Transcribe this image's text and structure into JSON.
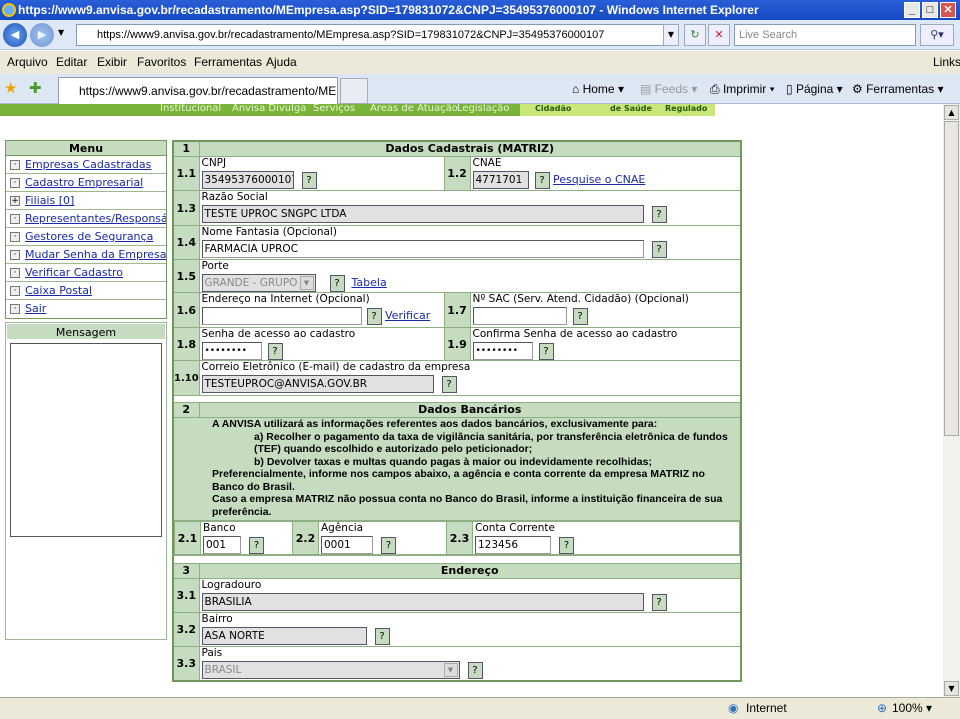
{
  "window": {
    "title": "https://www9.anvisa.gov.br/recadastramento/MEmpresa.asp?SID=179831072&CNPJ=35495376000107 - Windows Internet Explorer"
  },
  "browser": {
    "address": "https://www9.anvisa.gov.br/recadastramento/MEmpresa.asp?SID=179831072&CNPJ=35495376000107",
    "search_placeholder": "Live Search",
    "menu": [
      "Arquivo",
      "Editar",
      "Exibir",
      "Favoritos",
      "Ferramentas",
      "Ajuda"
    ],
    "links": "Links",
    "tab_title": "https://www9.anvisa.gov.br/recadastramento/MEmp...",
    "toolbar": {
      "home": "Home",
      "feeds": "Feeds",
      "print": "Imprimir",
      "page": "Página",
      "tools": "Ferramentas"
    },
    "status": {
      "zone": "Internet",
      "zoom": "100%"
    }
  },
  "site_nav": [
    "Institucional",
    "Anvisa Divulga",
    "Serviços",
    "Áreas de Atuação",
    "Legislação",
    "Cidadão",
    "de Saúde",
    "Regulado"
  ],
  "sidebar": {
    "title": "Menu",
    "items": [
      {
        "label": "Empresas Cadastradas",
        "icon": "·"
      },
      {
        "label": "Cadastro Empresarial",
        "icon": "·"
      },
      {
        "label": "Filiais [0]",
        "icon": "+"
      },
      {
        "label": "Representantes/Responsáveis",
        "icon": "·"
      },
      {
        "label": "Gestores de Segurança",
        "icon": "·"
      },
      {
        "label": "Mudar Senha da Empresa",
        "icon": "·"
      },
      {
        "label": "Verificar Cadastro",
        "icon": "·"
      },
      {
        "label": "Caixa Postal",
        "icon": "·"
      },
      {
        "label": "Sair",
        "icon": "·"
      }
    ],
    "message_title": "Mensagem"
  },
  "form": {
    "help": "?",
    "s1": {
      "num": "1",
      "title": "Dados Cadastrais (MATRIZ)",
      "cnpj": {
        "num": "1.1",
        "label": "CNPJ",
        "value": "35495376000107"
      },
      "cnae": {
        "num": "1.2",
        "label": "CNAE",
        "value": "4771701",
        "link": "Pesquise o CNAE"
      },
      "razao": {
        "num": "1.3",
        "label": "Razão Social",
        "value": "TESTE UPROC SNGPC LTDA"
      },
      "fantasia": {
        "num": "1.4",
        "label": "Nome Fantasia (Opcional)",
        "value": "FARMACIA UPROC"
      },
      "porte": {
        "num": "1.5",
        "label": "Porte",
        "value": "GRANDE - GRUPO I",
        "link": "Tabela"
      },
      "site": {
        "num": "1.6",
        "label": "Endereço na Internet (Opcional)",
        "value": "",
        "link": "Verificar"
      },
      "sac": {
        "num": "1.7",
        "label": "Nº SAC (Serv. Atend. Cidadão) (Opcional)",
        "value": ""
      },
      "senha": {
        "num": "1.8",
        "label": "Senha de acesso ao cadastro",
        "value": "••••••••"
      },
      "confirma": {
        "num": "1.9",
        "label": "Confirma Senha de acesso ao cadastro",
        "value": "••••••••"
      },
      "email": {
        "num": "1.10",
        "label": "Correio Eletrônico (E-mail) de cadastro da empresa",
        "value": "TESTEUPROC@ANVISA.GOV.BR"
      }
    },
    "s2": {
      "num": "2",
      "title": "Dados Bancários",
      "info": [
        "A ANVISA utilizará as informações referentes aos dados bancários, exclusivamente para:",
        "a) Recolher o pagamento da taxa de vigilância sanitária, por transferência eletrônica de fundos (TEF) quando escolhido e autorizado pelo peticionador;",
        "b) Devolver taxas e multas quando pagas à maior ou indevidamente recolhidas;",
        "Preferencialmente, informe nos campos abaixo, a agência e conta corrente da empresa MATRIZ no Banco do Brasil.",
        "Caso a empresa MATRIZ não possua conta no Banco do Brasil, informe a instituição financeira de sua preferência."
      ],
      "banco": {
        "num": "2.1",
        "label": "Banco",
        "value": "001"
      },
      "agencia": {
        "num": "2.2",
        "label": "Agência",
        "value": "0001"
      },
      "conta": {
        "num": "2.3",
        "label": "Conta Corrente",
        "value": "123456"
      }
    },
    "s3": {
      "num": "3",
      "title": "Endereço",
      "logradouro": {
        "num": "3.1",
        "label": "Logradouro",
        "value": "BRASILIA"
      },
      "bairro": {
        "num": "3.2",
        "label": "Bairro",
        "value": "ASA NORTE"
      },
      "pais": {
        "num": "3.3",
        "label": "Pais",
        "value": "BRASIL"
      }
    }
  }
}
